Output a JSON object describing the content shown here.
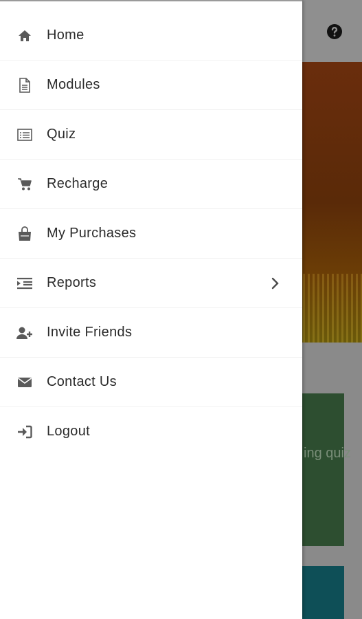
{
  "menu": {
    "items": [
      {
        "label": "Home",
        "icon": "home-icon"
      },
      {
        "label": "Modules",
        "icon": "document-icon"
      },
      {
        "label": "Quiz",
        "icon": "list-icon"
      },
      {
        "label": "Recharge",
        "icon": "cart-icon"
      },
      {
        "label": "My Purchases",
        "icon": "shopping-bag-icon"
      },
      {
        "label": "Reports",
        "icon": "indent-icon",
        "has_submenu": true
      },
      {
        "label": "Invite Friends",
        "icon": "user-plus-icon"
      },
      {
        "label": "Contact Us",
        "icon": "envelope-icon"
      },
      {
        "label": "Logout",
        "icon": "sign-in-icon"
      }
    ]
  },
  "background": {
    "card_text": "ing quiz"
  },
  "colors": {
    "drawer_bg": "#ffffff",
    "overlay": "#8c8c8c",
    "text": "#2b2b2b",
    "icon": "#5a5a5a",
    "green_card": "#2d4e30",
    "teal_card": "#0e4f57"
  }
}
